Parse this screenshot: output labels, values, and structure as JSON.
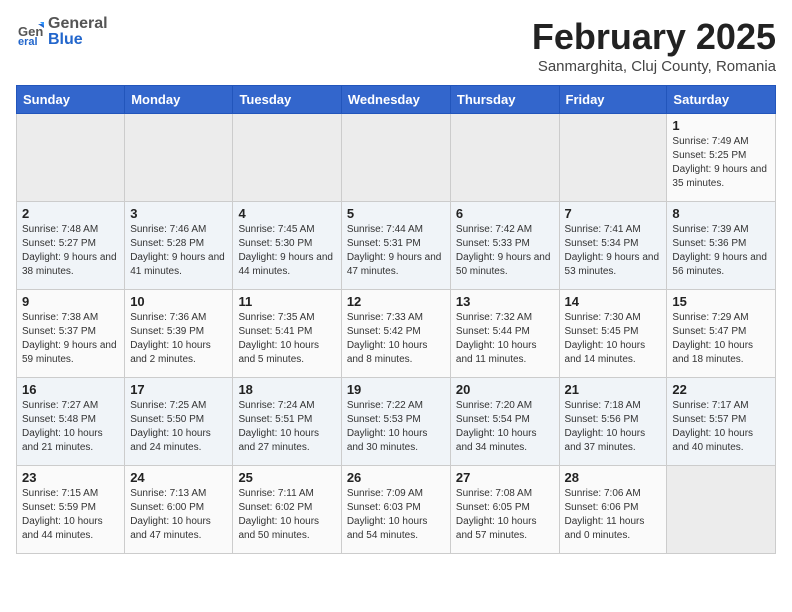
{
  "header": {
    "logo_general": "General",
    "logo_blue": "Blue",
    "month_title": "February 2025",
    "location": "Sanmarghita, Cluj County, Romania"
  },
  "weekdays": [
    "Sunday",
    "Monday",
    "Tuesday",
    "Wednesday",
    "Thursday",
    "Friday",
    "Saturday"
  ],
  "weeks": [
    [
      {
        "day": "",
        "info": ""
      },
      {
        "day": "",
        "info": ""
      },
      {
        "day": "",
        "info": ""
      },
      {
        "day": "",
        "info": ""
      },
      {
        "day": "",
        "info": ""
      },
      {
        "day": "",
        "info": ""
      },
      {
        "day": "1",
        "info": "Sunrise: 7:49 AM\nSunset: 5:25 PM\nDaylight: 9 hours and 35 minutes."
      }
    ],
    [
      {
        "day": "2",
        "info": "Sunrise: 7:48 AM\nSunset: 5:27 PM\nDaylight: 9 hours and 38 minutes."
      },
      {
        "day": "3",
        "info": "Sunrise: 7:46 AM\nSunset: 5:28 PM\nDaylight: 9 hours and 41 minutes."
      },
      {
        "day": "4",
        "info": "Sunrise: 7:45 AM\nSunset: 5:30 PM\nDaylight: 9 hours and 44 minutes."
      },
      {
        "day": "5",
        "info": "Sunrise: 7:44 AM\nSunset: 5:31 PM\nDaylight: 9 hours and 47 minutes."
      },
      {
        "day": "6",
        "info": "Sunrise: 7:42 AM\nSunset: 5:33 PM\nDaylight: 9 hours and 50 minutes."
      },
      {
        "day": "7",
        "info": "Sunrise: 7:41 AM\nSunset: 5:34 PM\nDaylight: 9 hours and 53 minutes."
      },
      {
        "day": "8",
        "info": "Sunrise: 7:39 AM\nSunset: 5:36 PM\nDaylight: 9 hours and 56 minutes."
      }
    ],
    [
      {
        "day": "9",
        "info": "Sunrise: 7:38 AM\nSunset: 5:37 PM\nDaylight: 9 hours and 59 minutes."
      },
      {
        "day": "10",
        "info": "Sunrise: 7:36 AM\nSunset: 5:39 PM\nDaylight: 10 hours and 2 minutes."
      },
      {
        "day": "11",
        "info": "Sunrise: 7:35 AM\nSunset: 5:41 PM\nDaylight: 10 hours and 5 minutes."
      },
      {
        "day": "12",
        "info": "Sunrise: 7:33 AM\nSunset: 5:42 PM\nDaylight: 10 hours and 8 minutes."
      },
      {
        "day": "13",
        "info": "Sunrise: 7:32 AM\nSunset: 5:44 PM\nDaylight: 10 hours and 11 minutes."
      },
      {
        "day": "14",
        "info": "Sunrise: 7:30 AM\nSunset: 5:45 PM\nDaylight: 10 hours and 14 minutes."
      },
      {
        "day": "15",
        "info": "Sunrise: 7:29 AM\nSunset: 5:47 PM\nDaylight: 10 hours and 18 minutes."
      }
    ],
    [
      {
        "day": "16",
        "info": "Sunrise: 7:27 AM\nSunset: 5:48 PM\nDaylight: 10 hours and 21 minutes."
      },
      {
        "day": "17",
        "info": "Sunrise: 7:25 AM\nSunset: 5:50 PM\nDaylight: 10 hours and 24 minutes."
      },
      {
        "day": "18",
        "info": "Sunrise: 7:24 AM\nSunset: 5:51 PM\nDaylight: 10 hours and 27 minutes."
      },
      {
        "day": "19",
        "info": "Sunrise: 7:22 AM\nSunset: 5:53 PM\nDaylight: 10 hours and 30 minutes."
      },
      {
        "day": "20",
        "info": "Sunrise: 7:20 AM\nSunset: 5:54 PM\nDaylight: 10 hours and 34 minutes."
      },
      {
        "day": "21",
        "info": "Sunrise: 7:18 AM\nSunset: 5:56 PM\nDaylight: 10 hours and 37 minutes."
      },
      {
        "day": "22",
        "info": "Sunrise: 7:17 AM\nSunset: 5:57 PM\nDaylight: 10 hours and 40 minutes."
      }
    ],
    [
      {
        "day": "23",
        "info": "Sunrise: 7:15 AM\nSunset: 5:59 PM\nDaylight: 10 hours and 44 minutes."
      },
      {
        "day": "24",
        "info": "Sunrise: 7:13 AM\nSunset: 6:00 PM\nDaylight: 10 hours and 47 minutes."
      },
      {
        "day": "25",
        "info": "Sunrise: 7:11 AM\nSunset: 6:02 PM\nDaylight: 10 hours and 50 minutes."
      },
      {
        "day": "26",
        "info": "Sunrise: 7:09 AM\nSunset: 6:03 PM\nDaylight: 10 hours and 54 minutes."
      },
      {
        "day": "27",
        "info": "Sunrise: 7:08 AM\nSunset: 6:05 PM\nDaylight: 10 hours and 57 minutes."
      },
      {
        "day": "28",
        "info": "Sunrise: 7:06 AM\nSunset: 6:06 PM\nDaylight: 11 hours and 0 minutes."
      },
      {
        "day": "",
        "info": ""
      }
    ]
  ]
}
